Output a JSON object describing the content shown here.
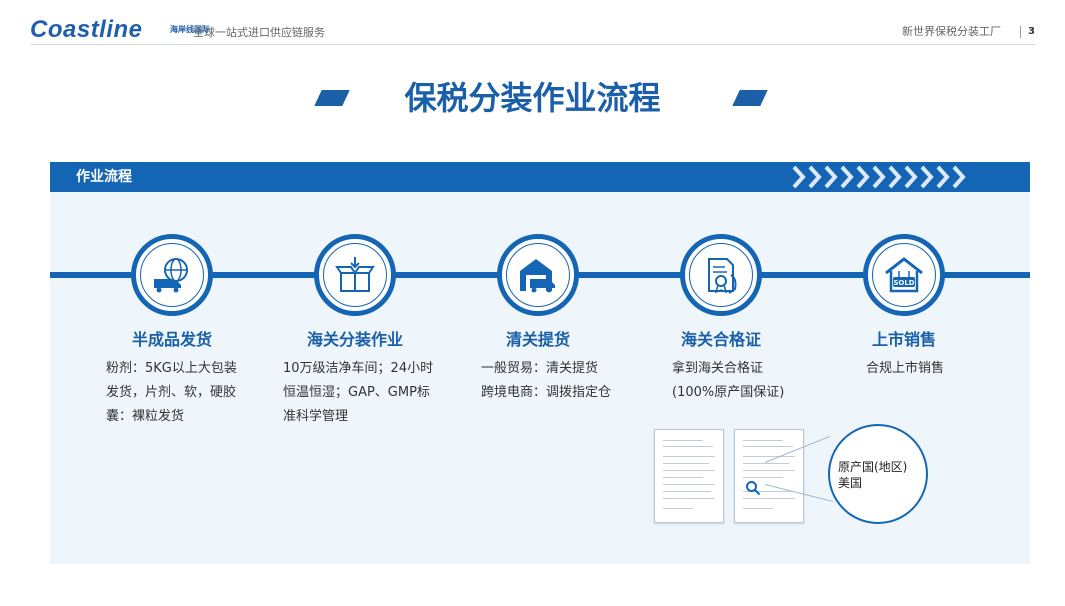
{
  "header": {
    "logo": "Coastline",
    "logo_cn": "海岸线国际",
    "tagline": "· 全球一站式进口供应链服务",
    "right_text": "新世界保税分装工厂",
    "page_number": "3"
  },
  "title": "保税分装作业流程",
  "section_label": "作业流程",
  "steps": [
    {
      "title": "半成品发货",
      "icon": "globe-truck-icon",
      "desc": [
        "粉剂：5KG以上大包装",
        "发货，片剂、软，硬胶",
        "囊：裸粒发货"
      ]
    },
    {
      "title": "海关分装作业",
      "icon": "open-box-icon",
      "desc": [
        "10万级洁净车间；24小时",
        "恒温恒湿；GAP、GMP标",
        "准科学管理"
      ]
    },
    {
      "title": "清关提货",
      "icon": "warehouse-truck-icon",
      "desc": [
        "一般贸易：清关提货",
        "跨境电商：调拨指定仓"
      ]
    },
    {
      "title": "海关合格证",
      "icon": "certificate-hand-icon",
      "desc": [
        "拿到海关合格证",
        "(100%原产国保证)"
      ]
    },
    {
      "title": "上市销售",
      "icon": "sold-house-icon",
      "desc": [
        "合规上市销售"
      ]
    }
  ],
  "callout": {
    "line1": "原产国(地区)",
    "line2": "美国"
  },
  "colors": {
    "primary": "#1565b5",
    "title": "#1a5fa8",
    "card_bg": "#eef6fc"
  }
}
